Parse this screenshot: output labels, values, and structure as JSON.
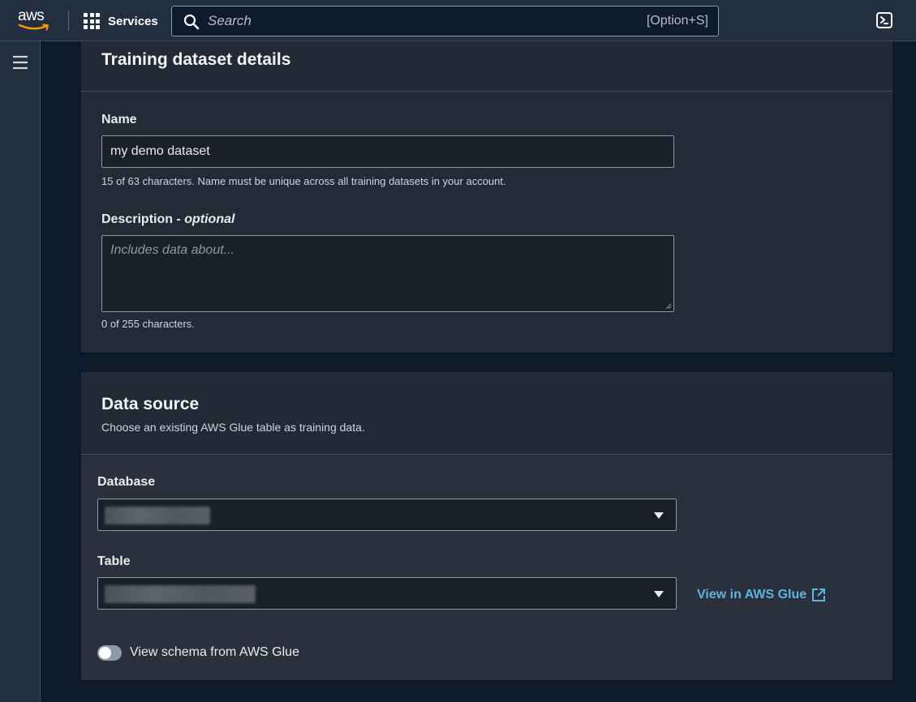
{
  "topbar": {
    "logo_text": "aws",
    "services_label": "Services",
    "search_placeholder": "Search",
    "search_shortcut": "[Option+S]"
  },
  "training_dataset": {
    "title": "Training dataset details",
    "name_label": "Name",
    "name_value": "my demo dataset",
    "name_hint": "15 of 63 characters. Name must be unique across all training datasets in your account.",
    "description_label": "Description - ",
    "description_optional": "optional",
    "description_placeholder": "Includes data about...",
    "description_value": "",
    "description_hint": "0 of 255 characters."
  },
  "data_source": {
    "title": "Data source",
    "subtitle": "Choose an existing AWS Glue table as training data.",
    "database_label": "Database",
    "table_label": "Table",
    "view_link_label": "View in AWS Glue",
    "toggle_label": "View schema from AWS Glue",
    "toggle_on": false
  },
  "colors": {
    "link": "#5fb3e0",
    "topbar_bg": "#232f3e",
    "page_bg": "#0f1b2a"
  }
}
